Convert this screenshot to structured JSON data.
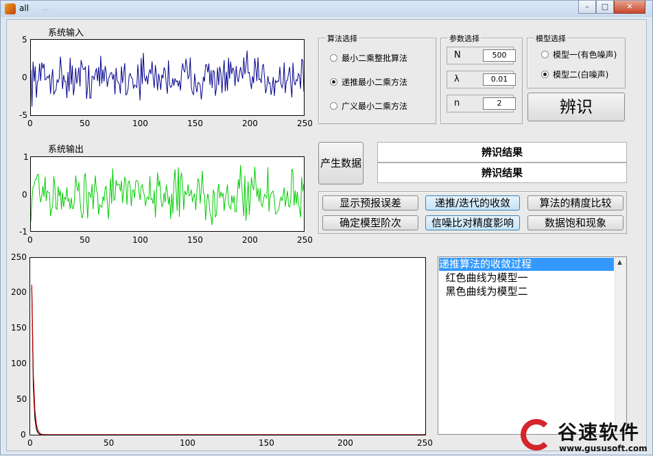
{
  "window": {
    "title": "all",
    "title_ghost": "...",
    "controls": {
      "minimize": "–",
      "maximize": "□",
      "close": "✕"
    }
  },
  "axes_input": {
    "title": "系统输入",
    "yticks": [
      "5",
      "0",
      "-5"
    ],
    "xticks": [
      "0",
      "50",
      "100",
      "150",
      "200",
      "250"
    ]
  },
  "axes_output": {
    "title": "系统输出",
    "yticks": [
      "1",
      "0",
      "-1"
    ],
    "xticks": [
      "0",
      "50",
      "100",
      "150",
      "200",
      "250"
    ]
  },
  "axes_conv": {
    "yticks": [
      "250",
      "200",
      "150",
      "100",
      "50",
      "0"
    ],
    "xticks": [
      "0",
      "50",
      "100",
      "150",
      "200",
      "250"
    ]
  },
  "algo_panel": {
    "title": "算法选择",
    "options": [
      "最小二乘整批算法",
      "递推最小二乘方法",
      "广义最小二乘方法"
    ],
    "selected_index": 1
  },
  "param_panel": {
    "title": "参数选择",
    "params": [
      {
        "label": "N",
        "value": "500"
      },
      {
        "label": "λ",
        "value": "0.01"
      },
      {
        "label": "n",
        "value": "2"
      }
    ]
  },
  "model_panel": {
    "title": "模型选择",
    "options": [
      "模型一(有色噪声)",
      "模型二(白噪声)"
    ],
    "selected_index": 1
  },
  "buttons": {
    "identify": "辨识",
    "generate": "产生数据",
    "show_pred_err": "显示预报误差",
    "convergence": "递推/迭代的收敛",
    "precision": "算法的精度比较",
    "model_order": "确定模型阶次",
    "snr": "信噪比对精度影响",
    "saturation": "数据饱和现象"
  },
  "results": [
    "辨识结果",
    "辨识结果"
  ],
  "listbox": {
    "items": [
      "递推算法的收敛过程",
      "  红色曲线为模型一",
      "  黑色曲线为模型二"
    ],
    "selected_index": 0
  },
  "watermark": {
    "name": "谷速软件",
    "url": "www.gususoft.com"
  },
  "colors": {
    "input_line": "#00008b",
    "output_line": "#00cc00",
    "conv_red": "#cc0000",
    "conv_black": "#000000"
  }
}
